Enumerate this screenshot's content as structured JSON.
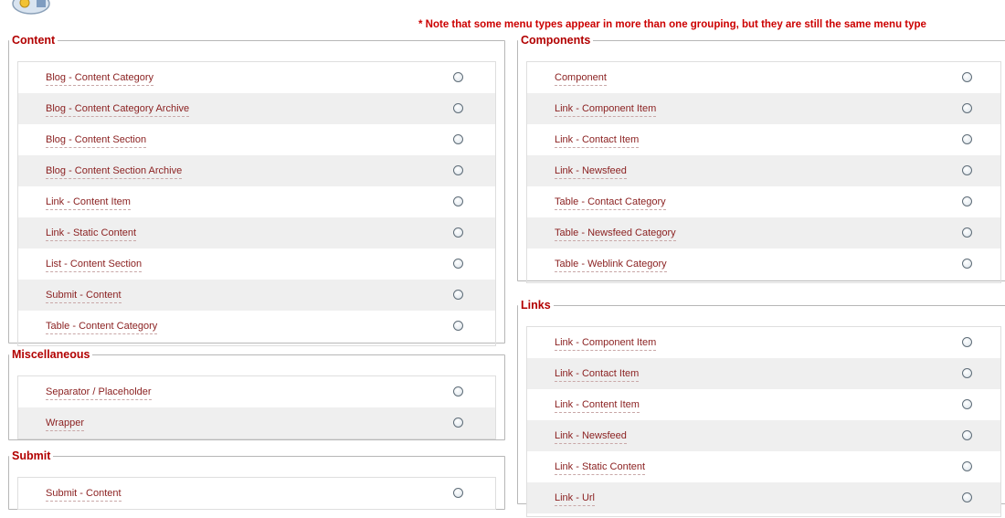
{
  "note": "* Note that some menu types appear in more than one grouping, but they are still the same menu type",
  "groups": {
    "content": {
      "title": "Content",
      "items": [
        "Blog - Content Category",
        "Blog - Content Category Archive",
        "Blog - Content Section",
        "Blog - Content Section Archive",
        "Link - Content Item",
        "Link - Static Content",
        "List - Content Section",
        "Submit - Content",
        "Table - Content Category"
      ]
    },
    "miscellaneous": {
      "title": "Miscellaneous",
      "items": [
        "Separator / Placeholder",
        "Wrapper"
      ]
    },
    "submit": {
      "title": "Submit",
      "items": [
        "Submit - Content"
      ]
    },
    "components": {
      "title": "Components",
      "items": [
        "Component",
        "Link - Component Item",
        "Link - Contact Item",
        "Link - Newsfeed",
        "Table - Contact Category",
        "Table - Newsfeed Category",
        "Table - Weblink Category"
      ]
    },
    "links": {
      "title": "Links",
      "items": [
        "Link - Component Item",
        "Link - Contact Item",
        "Link - Content Item",
        "Link - Newsfeed",
        "Link - Static Content",
        "Link - Url"
      ]
    }
  },
  "colors": {
    "legend": "#b20000",
    "note": "#cc0000",
    "item": "#8a1f1f",
    "alt_row": "#efefef"
  },
  "icons": {
    "logo": "menu-manager-icon",
    "radio": "radio-button-icon"
  }
}
